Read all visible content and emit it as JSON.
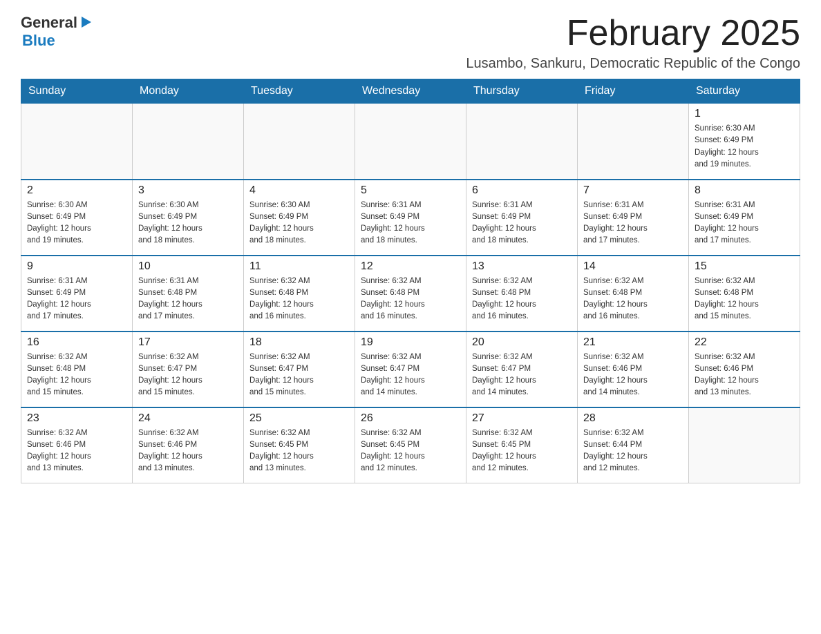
{
  "header": {
    "logo_general": "General",
    "logo_blue": "Blue",
    "month_title": "February 2025",
    "location": "Lusambo, Sankuru, Democratic Republic of the Congo"
  },
  "weekdays": [
    "Sunday",
    "Monday",
    "Tuesday",
    "Wednesday",
    "Thursday",
    "Friday",
    "Saturday"
  ],
  "weeks": [
    [
      {
        "day": "",
        "info": ""
      },
      {
        "day": "",
        "info": ""
      },
      {
        "day": "",
        "info": ""
      },
      {
        "day": "",
        "info": ""
      },
      {
        "day": "",
        "info": ""
      },
      {
        "day": "",
        "info": ""
      },
      {
        "day": "1",
        "info": "Sunrise: 6:30 AM\nSunset: 6:49 PM\nDaylight: 12 hours\nand 19 minutes."
      }
    ],
    [
      {
        "day": "2",
        "info": "Sunrise: 6:30 AM\nSunset: 6:49 PM\nDaylight: 12 hours\nand 19 minutes."
      },
      {
        "day": "3",
        "info": "Sunrise: 6:30 AM\nSunset: 6:49 PM\nDaylight: 12 hours\nand 18 minutes."
      },
      {
        "day": "4",
        "info": "Sunrise: 6:30 AM\nSunset: 6:49 PM\nDaylight: 12 hours\nand 18 minutes."
      },
      {
        "day": "5",
        "info": "Sunrise: 6:31 AM\nSunset: 6:49 PM\nDaylight: 12 hours\nand 18 minutes."
      },
      {
        "day": "6",
        "info": "Sunrise: 6:31 AM\nSunset: 6:49 PM\nDaylight: 12 hours\nand 18 minutes."
      },
      {
        "day": "7",
        "info": "Sunrise: 6:31 AM\nSunset: 6:49 PM\nDaylight: 12 hours\nand 17 minutes."
      },
      {
        "day": "8",
        "info": "Sunrise: 6:31 AM\nSunset: 6:49 PM\nDaylight: 12 hours\nand 17 minutes."
      }
    ],
    [
      {
        "day": "9",
        "info": "Sunrise: 6:31 AM\nSunset: 6:49 PM\nDaylight: 12 hours\nand 17 minutes."
      },
      {
        "day": "10",
        "info": "Sunrise: 6:31 AM\nSunset: 6:48 PM\nDaylight: 12 hours\nand 17 minutes."
      },
      {
        "day": "11",
        "info": "Sunrise: 6:32 AM\nSunset: 6:48 PM\nDaylight: 12 hours\nand 16 minutes."
      },
      {
        "day": "12",
        "info": "Sunrise: 6:32 AM\nSunset: 6:48 PM\nDaylight: 12 hours\nand 16 minutes."
      },
      {
        "day": "13",
        "info": "Sunrise: 6:32 AM\nSunset: 6:48 PM\nDaylight: 12 hours\nand 16 minutes."
      },
      {
        "day": "14",
        "info": "Sunrise: 6:32 AM\nSunset: 6:48 PM\nDaylight: 12 hours\nand 16 minutes."
      },
      {
        "day": "15",
        "info": "Sunrise: 6:32 AM\nSunset: 6:48 PM\nDaylight: 12 hours\nand 15 minutes."
      }
    ],
    [
      {
        "day": "16",
        "info": "Sunrise: 6:32 AM\nSunset: 6:48 PM\nDaylight: 12 hours\nand 15 minutes."
      },
      {
        "day": "17",
        "info": "Sunrise: 6:32 AM\nSunset: 6:47 PM\nDaylight: 12 hours\nand 15 minutes."
      },
      {
        "day": "18",
        "info": "Sunrise: 6:32 AM\nSunset: 6:47 PM\nDaylight: 12 hours\nand 15 minutes."
      },
      {
        "day": "19",
        "info": "Sunrise: 6:32 AM\nSunset: 6:47 PM\nDaylight: 12 hours\nand 14 minutes."
      },
      {
        "day": "20",
        "info": "Sunrise: 6:32 AM\nSunset: 6:47 PM\nDaylight: 12 hours\nand 14 minutes."
      },
      {
        "day": "21",
        "info": "Sunrise: 6:32 AM\nSunset: 6:46 PM\nDaylight: 12 hours\nand 14 minutes."
      },
      {
        "day": "22",
        "info": "Sunrise: 6:32 AM\nSunset: 6:46 PM\nDaylight: 12 hours\nand 13 minutes."
      }
    ],
    [
      {
        "day": "23",
        "info": "Sunrise: 6:32 AM\nSunset: 6:46 PM\nDaylight: 12 hours\nand 13 minutes."
      },
      {
        "day": "24",
        "info": "Sunrise: 6:32 AM\nSunset: 6:46 PM\nDaylight: 12 hours\nand 13 minutes."
      },
      {
        "day": "25",
        "info": "Sunrise: 6:32 AM\nSunset: 6:45 PM\nDaylight: 12 hours\nand 13 minutes."
      },
      {
        "day": "26",
        "info": "Sunrise: 6:32 AM\nSunset: 6:45 PM\nDaylight: 12 hours\nand 12 minutes."
      },
      {
        "day": "27",
        "info": "Sunrise: 6:32 AM\nSunset: 6:45 PM\nDaylight: 12 hours\nand 12 minutes."
      },
      {
        "day": "28",
        "info": "Sunrise: 6:32 AM\nSunset: 6:44 PM\nDaylight: 12 hours\nand 12 minutes."
      },
      {
        "day": "",
        "info": ""
      }
    ]
  ]
}
